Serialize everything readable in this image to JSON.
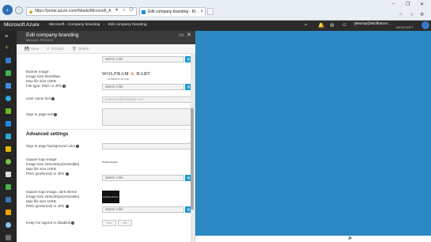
{
  "browser": {
    "url": "https://portal.azure.com/#blade/Microsoft_A",
    "tab_title": "Edit company branding - M...",
    "addr_icons": "▼ ⌕ ⟳"
  },
  "azure": {
    "brand": "Microsoft Azure",
    "breadcrumb": [
      "Microsoft - Company branding",
      "Edit company branding"
    ],
    "user_email": "Murray@WolframAr...",
    "user_tenant": "MICROSOFT",
    "colors": {
      "topbar": "#2b2b2b",
      "accent": "#1c9ad6",
      "main_bg": "#2b88c3"
    }
  },
  "blade": {
    "title": "Edit company branding",
    "subtitle": "Microsoft - PREVIEW",
    "commands": {
      "save": "Save",
      "discard": "Discard",
      "delete": "Delete"
    },
    "fields": {
      "select_file_placeholder": "Select a file",
      "banner_image_label": [
        "Banner image",
        "Image size 60x280px",
        "Max file size 10KB",
        "File type: PNG or JPG"
      ],
      "banner_logo_main": "WOLFRAM",
      "banner_logo_amp": "&",
      "banner_logo_end": "HART",
      "banner_logo_tag": "ATTORNEYS AT LAW",
      "user_name_hint_label": "User name hint",
      "user_name_hint_placeholder": "someone@example.com",
      "sign_in_text_label": "Sign-in page text",
      "advanced_title": "Advanced settings",
      "bg_color_label": "Sign-in page background color",
      "square_logo_label": [
        "Square logo image",
        "Image size 240x240px(resizable)",
        "Max file size 10KB",
        "PNG (preferred) or JPG"
      ],
      "square_logo_text": "Wolfram & Hart",
      "square_dark_label": [
        "Square logo image, dark theme",
        "Image size 240x240px(resizable)",
        "Max file size 10KB",
        "PNG (preferred) or JPG"
      ],
      "square_dark_text": "Wolfram & Hart",
      "keep_signed_label": "Keep me signed in disabled",
      "toggle_yes": "Yes",
      "toggle_no": "No"
    }
  }
}
